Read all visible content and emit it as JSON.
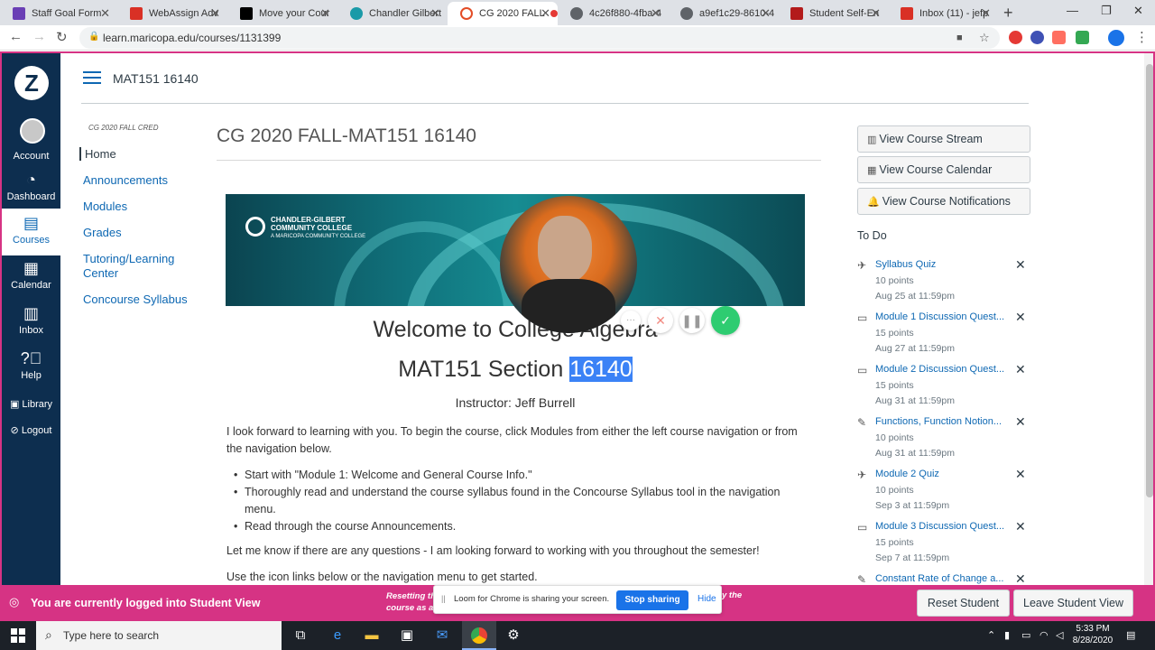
{
  "browser": {
    "tabs": [
      {
        "title": "Staff Goal Form",
        "color": "#6a3fb5"
      },
      {
        "title": "WebAssign Adv",
        "color": "#d93025"
      },
      {
        "title": "Move your Cour",
        "color": "#000000"
      },
      {
        "title": "Chandler Gilbert",
        "color": "#1a9aa8"
      },
      {
        "title": "CG 2020 FALL",
        "color": "#e34c26"
      },
      {
        "title": "4c26f880-4fba-4",
        "color": "#5f6368"
      },
      {
        "title": "a9ef1c29-8610-4",
        "color": "#5f6368"
      },
      {
        "title": "Student Self-En",
        "color": "#b31b1b"
      },
      {
        "title": "Inbox (11) - jefp",
        "color": "#d93025"
      }
    ],
    "url": "learn.maricopa.edu/courses/1131399"
  },
  "global_nav": {
    "items": [
      {
        "label": "Account",
        "icon": "avatar-icon"
      },
      {
        "label": "Dashboard",
        "icon": "dashboard-icon"
      },
      {
        "label": "Courses",
        "icon": "courses-icon"
      },
      {
        "label": "Calendar",
        "icon": "calendar-icon"
      },
      {
        "label": "Inbox",
        "icon": "inbox-icon"
      },
      {
        "label": "Help",
        "icon": "help-icon"
      },
      {
        "label": "Library",
        "icon": "library-icon"
      },
      {
        "label": "Logout",
        "icon": "logout-icon"
      }
    ]
  },
  "header": {
    "course_code": "MAT151 16140"
  },
  "course_nav": {
    "term": "CG 2020 FALL CRED",
    "items": [
      "Home",
      "Announcements",
      "Modules",
      "Grades",
      "Tutoring/Learning Center",
      "Concourse Syllabus"
    ]
  },
  "main": {
    "title": "CG 2020 FALL-MAT151 16140",
    "banner": {
      "college_name_line1": "CHANDLER-GILBERT",
      "college_name_line2": "COMMUNITY COLLEGE",
      "college_sub": "A MARICOPA COMMUNITY COLLEGE"
    },
    "welcome": "Welcome to College Algebra",
    "section_prefix": "MAT151 Section ",
    "section_number": "16140",
    "instructor": "Instructor: Jeff Burrell",
    "intro": "I look forward to learning with you.   To begin the course, click Modules from either the left course navigation or from the navigation below.",
    "bullets": [
      "Start with \"Module 1: Welcome and General Course Info.\"",
      "Thoroughly read and understand the course syllabus found in the Concourse Syllabus tool in the navigation menu.",
      "Read through the course Announcements."
    ],
    "let_me_know": "Let me know if there are any questions - I am looking forward to working with you throughout the semester!",
    "use_icons": "Use the icon links below or the navigation menu to get started."
  },
  "sidebar": {
    "buttons": [
      "View Course Stream",
      "View Course Calendar",
      "View Course Notifications"
    ],
    "todo_title": "To Do",
    "todos": [
      {
        "title": "Syllabus Quiz",
        "points": "10 points",
        "due": "Aug 25 at 11:59pm",
        "icon": "quiz-icon"
      },
      {
        "title": "Module 1 Discussion Quest...",
        "points": "15 points",
        "due": "Aug 27 at 11:59pm",
        "icon": "discussion-icon"
      },
      {
        "title": "Module 2 Discussion Quest...",
        "points": "15 points",
        "due": "Aug 31 at 11:59pm",
        "icon": "discussion-icon"
      },
      {
        "title": "Functions, Function Notion...",
        "points": "10 points",
        "due": "Aug 31 at 11:59pm",
        "icon": "assignment-icon"
      },
      {
        "title": "Module 2 Quiz",
        "points": "10 points",
        "due": "Sep 3 at 11:59pm",
        "icon": "quiz-icon"
      },
      {
        "title": "Module 3 Discussion Quest...",
        "points": "15 points",
        "due": "Sep 7 at 11:59pm",
        "icon": "discussion-icon"
      },
      {
        "title": "Constant Rate of Change a...",
        "points": "",
        "due": "",
        "icon": "assignment-icon"
      }
    ]
  },
  "student_view": {
    "message": "You are currently logged into Student View",
    "reset_note_start": "Resetting th",
    "reset_note_start2": "course as a",
    "reset_note_end": "y the",
    "reset_button": "Reset Student",
    "leave_button": "Leave Student View"
  },
  "loom": {
    "message": "Loom for Chrome is sharing your screen.",
    "stop_button": "Stop sharing",
    "hide_link": "Hide"
  },
  "taskbar": {
    "search_placeholder": "Type here to search",
    "time": "5:33 PM",
    "date": "8/28/2020"
  }
}
